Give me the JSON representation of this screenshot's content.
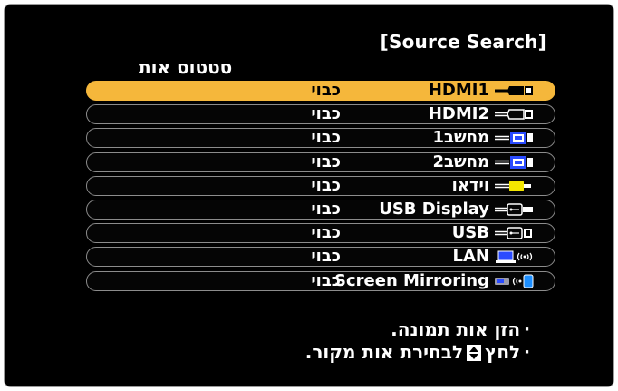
{
  "title": "[Source Search]",
  "column_header": "סטטוס אות",
  "rows": [
    {
      "source": "HDMI1",
      "status": "כבוי",
      "icon": "hdmi-connector-icon",
      "selected": true
    },
    {
      "source": "HDMI2",
      "status": "כבוי",
      "icon": "hdmi-connector-icon",
      "selected": false
    },
    {
      "source": "מחשב1",
      "status": "כבוי",
      "icon": "vga-computer-connector-icon",
      "selected": false
    },
    {
      "source": "מחשב2",
      "status": "כבוי",
      "icon": "vga-computer-connector-icon",
      "selected": false
    },
    {
      "source": "וידאו",
      "status": "כבוי",
      "icon": "rca-video-connector-icon",
      "selected": false
    },
    {
      "source": "USB Display",
      "status": "כבוי",
      "icon": "usb-connector-icon",
      "selected": false
    },
    {
      "source": "USB",
      "status": "כבוי",
      "icon": "usb-connector-icon",
      "selected": false
    },
    {
      "source": "LAN",
      "status": "כבוי",
      "icon": "lan-wireless-icon",
      "selected": false
    },
    {
      "source": "Screen Mirroring",
      "status": "כבוי",
      "icon": "screen-mirroring-icon",
      "selected": false
    }
  ],
  "hints": {
    "line1": "הזן אות תמונה.",
    "line2_prefix": "לחץ",
    "line2_suffix": "לבחירת אות מקור."
  },
  "colors": {
    "background": "#000000",
    "selected_row": "#f5b73b",
    "row_border": "#8c8c8c",
    "text": "#ffffff",
    "vga_blue": "#2a4bff",
    "video_yellow": "#f3e600"
  }
}
